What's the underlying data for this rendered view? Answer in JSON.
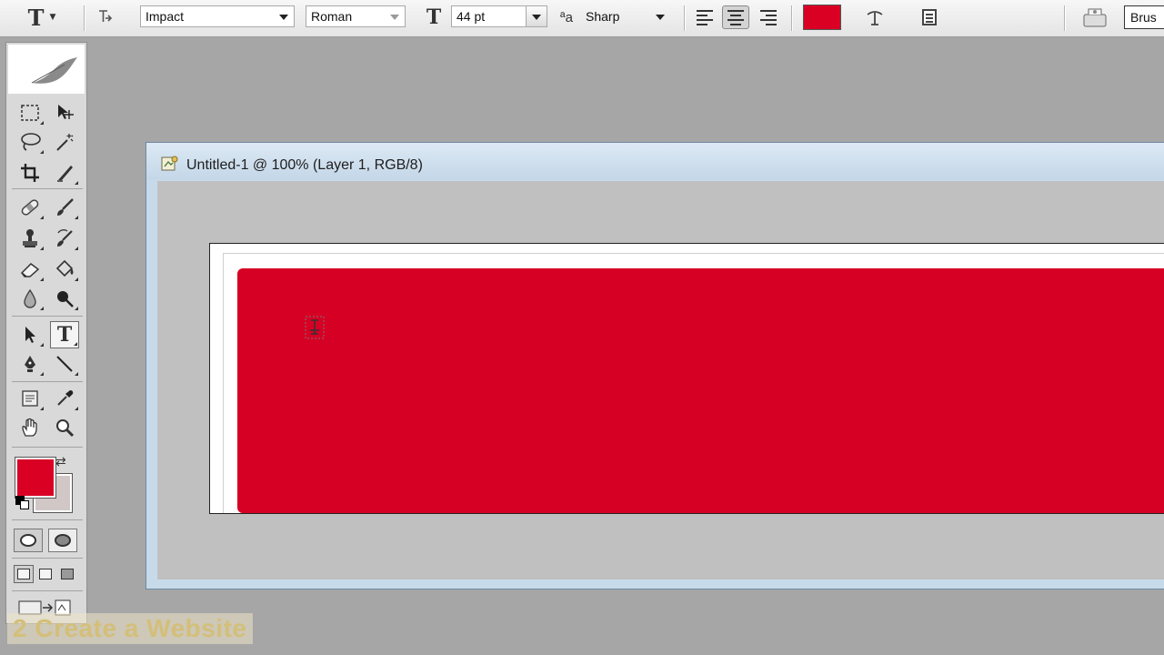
{
  "options_bar": {
    "tool_glyph": "T",
    "font_family": "Impact",
    "font_style": "Roman",
    "font_size": "44 pt",
    "antialias": "Sharp",
    "text_color": "#d90024",
    "right_tab_label": "Brus"
  },
  "tools": {
    "foreground_color": "#d90024",
    "background_color": "#d2c7c7",
    "selected_tool": "type-tool"
  },
  "document": {
    "title": "Untitled-1 @ 100% (Layer 1, RGB/8)",
    "fill_color": "#d60024"
  },
  "watermark": {
    "text": "2 Create a Website"
  }
}
